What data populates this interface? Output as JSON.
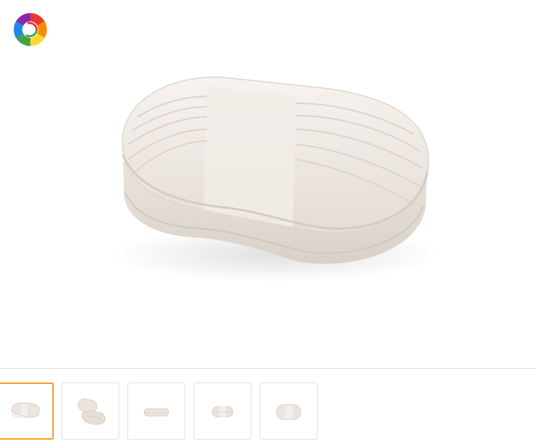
{
  "gallery": {
    "logo_icon": "rainbow-swirl-logo",
    "product_image_icon": "soap-dish-box",
    "product_color": "#ebe5de",
    "accent_color": "#f29a1f",
    "active_thumbnail": 0,
    "thumbnails": [
      {
        "icon": "soap-dish-closed-angle"
      },
      {
        "icon": "soap-dish-open"
      },
      {
        "icon": "soap-dish-side-flat"
      },
      {
        "icon": "soap-dish-side-front"
      },
      {
        "icon": "soap-dish-top"
      }
    ]
  }
}
